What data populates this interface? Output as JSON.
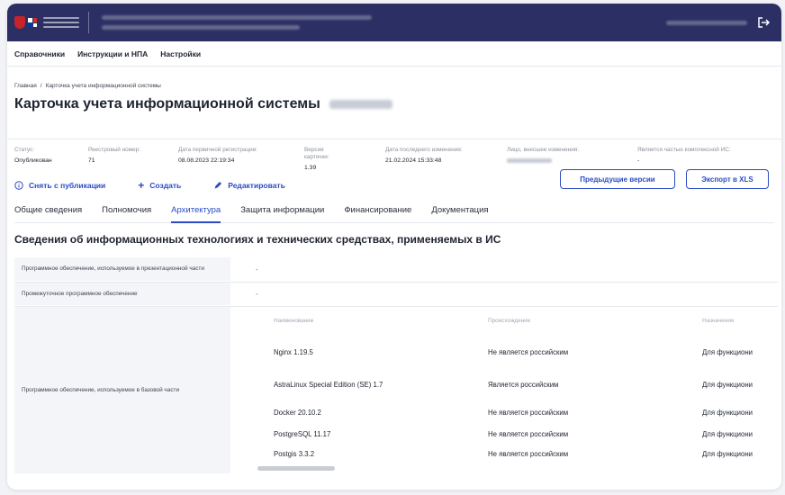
{
  "header": {
    "flag_colors": [
      "#ffffff",
      "#d52b1e",
      "#0039a6",
      "#ffffff"
    ]
  },
  "menu": {
    "items": [
      "Справочники",
      "Инструкции и НПА",
      "Настройки"
    ]
  },
  "breadcrumb": {
    "home": "Главная",
    "separator": "/",
    "current": "Карточка учета информационной системы"
  },
  "page": {
    "title": "Карточка учета информационной системы"
  },
  "meta": {
    "status_label": "Статус:",
    "status_value": "Опубликован",
    "reg_number_label": "Реестровый номер:",
    "reg_number_value": "71",
    "first_reg_label": "Дата первичной регистрации:",
    "first_reg_value": "08.08.2023 22:19:34",
    "version_label": "Версия карточки:",
    "version_value": "1.39",
    "last_change_label": "Дата последнего изменения:",
    "last_change_value": "21.02.2024 15:33:48",
    "changed_by_label": "Лицо, внесшее изменения:",
    "complex_part_label": "Является частью комплексной ИС:",
    "complex_part_value": "-"
  },
  "actions": {
    "unpublish": "Снять с публикации",
    "create": "Создать",
    "edit": "Редактировать",
    "prev_versions": "Предыдущие версии",
    "export_xls": "Экспорт в XLS"
  },
  "tabs": [
    "Общие сведения",
    "Полномочия",
    "Архитектура",
    "Защита информации",
    "Финансирование",
    "Документация"
  ],
  "active_tab": "Архитектура",
  "section": {
    "title": "Сведения об информационных технологиях и технических средствах, применяемых в ИС"
  },
  "rows": {
    "presentation_label": "Программное обеспечение, используемое в презентационной части",
    "presentation_value": "-",
    "middleware_label": "Промежуточное программное обеспечение",
    "middleware_value": "-",
    "base_label": "Программное обеспечение, используемое в базовой части"
  },
  "software_table": {
    "columns": [
      "Наименование",
      "Происхождение",
      "Назначение"
    ],
    "rows": [
      [
        "Nginx 1.19.5",
        "Не является российским",
        "Для функциони"
      ],
      [
        "AstraLinux Special Edition (SE) 1.7",
        "Является российским",
        "Для функциони"
      ],
      [
        "Docker 20.10.2",
        "Не является российским",
        "Для функциони"
      ],
      [
        "PostgreSQL 11.17",
        "Не является российским",
        "Для функциони"
      ],
      [
        "Postgis 3.3.2",
        "Не является российским",
        "Для функциони"
      ]
    ]
  },
  "colors": {
    "header_bg": "#2b2f63",
    "accent": "#2b4bc4"
  }
}
